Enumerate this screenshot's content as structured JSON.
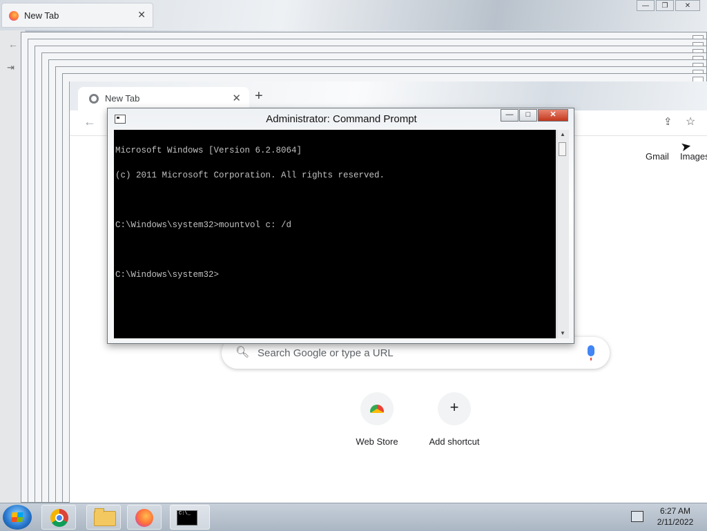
{
  "firefox": {
    "tab_title": "New Tab",
    "tab_close": "✕",
    "win_min": "—",
    "win_max": "❐",
    "win_close": "✕"
  },
  "chrome": {
    "tab_title": "New Tab",
    "tab_close": "✕",
    "new_tab": "+",
    "back": "←",
    "links": {
      "gmail": "Gmail",
      "images": "Images"
    },
    "search": {
      "placeholder": "Search Google or type a URL"
    },
    "shortcuts": [
      {
        "label": "Web Store"
      },
      {
        "label": "Add shortcut",
        "glyph": "+"
      }
    ]
  },
  "cmd": {
    "title": "Administrator: Command Prompt",
    "min": "—",
    "max": "□",
    "close": "✕",
    "lines": [
      "Microsoft Windows [Version 6.2.8064]",
      "(c) 2011 Microsoft Corporation. All rights reserved.",
      "",
      "C:\\Windows\\system32>mountvol c: /d",
      "",
      "C:\\Windows\\system32>"
    ]
  },
  "taskbar": {
    "time": "6:27 AM",
    "date": "2/11/2022",
    "cmd_icon_text": "C:\\_"
  },
  "icons": [
    "firefox-icon",
    "chrome-icon",
    "back-arrow-icon",
    "share-icon",
    "star-icon",
    "search-icon",
    "mic-icon",
    "windows-start-icon",
    "folder-icon",
    "cmd-icon",
    "network-icon"
  ],
  "colors": {
    "console_bg": "#000000",
    "console_fg": "#c0c0c0",
    "close_red": "#c2371d"
  }
}
